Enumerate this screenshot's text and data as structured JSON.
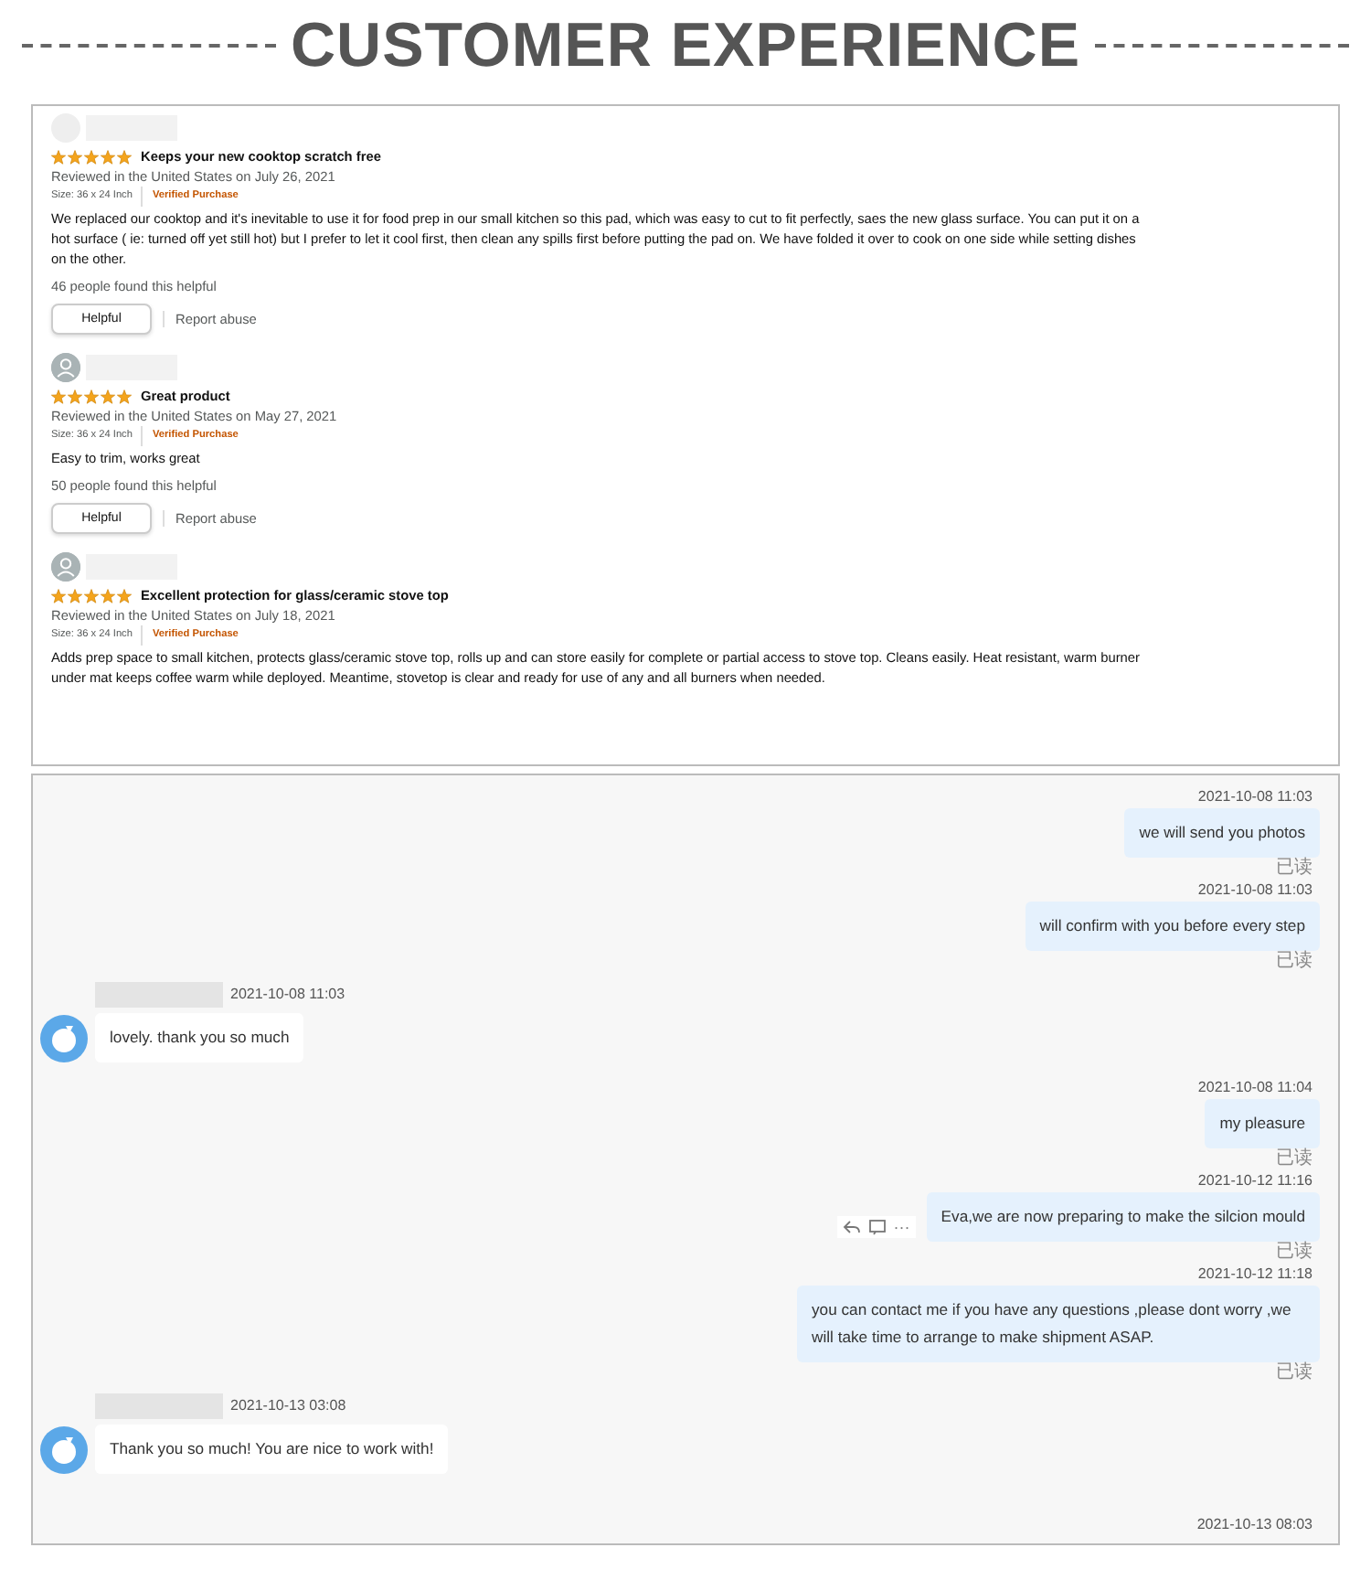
{
  "heading": "CUSTOMER EXPERIENCE",
  "reviews": [
    {
      "avatar": {
        "kind": "blank"
      },
      "stars": 5,
      "title": "Keeps your new cooktop scratch free",
      "reviewed": "Reviewed in the United States on July 26, 2021",
      "size": "Size: 36 x 24 Inch",
      "badge": "Verified Purchase",
      "body": "We replaced our cooktop and it's inevitable to use it for food prep in our small kitchen so this pad, which was easy to cut to fit perfectly, saes the new glass surface. You can put it on a hot surface ( ie: turned off yet still hot) but I prefer to let it cool first, then clean any spills first before putting the pad on. We have folded it over to cook on one side while setting dishes on the other.",
      "helpful_count": "46 people found this helpful",
      "helpful_button": "Helpful",
      "report": "Report abuse"
    },
    {
      "avatar": {
        "kind": "person"
      },
      "stars": 5,
      "title": "Great product",
      "reviewed": "Reviewed in the United States on May 27, 2021",
      "size": "Size: 36 x 24 Inch",
      "badge": "Verified Purchase",
      "body": "Easy to trim, works great",
      "helpful_count": "50 people found this helpful",
      "helpful_button": "Helpful",
      "report": "Report abuse"
    },
    {
      "avatar": {
        "kind": "person"
      },
      "stars": 5,
      "title": "Excellent protection for glass/ceramic stove top",
      "reviewed": "Reviewed in the United States on July 18, 2021",
      "size": "Size: 36 x 24 Inch",
      "badge": "Verified Purchase",
      "body": "Adds prep space to small kitchen, protects glass/ceramic stove top, rolls up and can store easily for complete or partial access to stove top. Cleans easily. Heat resistant, warm burner under mat keeps coffee warm while deployed. Meantime, stovetop is clear and ready for use of any and all burners when needed."
    }
  ],
  "chat": [
    {
      "kind": "outgoing",
      "time": "2021-10-08 11:03",
      "text": "we will send you photos",
      "status": "已读",
      "show_actions": false
    },
    {
      "kind": "outgoing",
      "time": "2021-10-08 11:03",
      "text": "will confirm with you before every step",
      "status": "已读",
      "show_actions": false
    },
    {
      "kind": "incoming",
      "time": "2021-10-08 11:03",
      "text": "lovely. thank you so much"
    },
    {
      "kind": "outgoing",
      "time": "2021-10-08 11:04",
      "text": "my pleasure",
      "status": "已读",
      "show_actions": false
    },
    {
      "kind": "outgoing",
      "time": "2021-10-12 11:16",
      "text": "Eva,we are now preparing to make the silcion mould",
      "status": "已读",
      "show_actions": true,
      "more": "···"
    },
    {
      "kind": "outgoing",
      "time": "2021-10-12 11:18",
      "text": "you can contact me if you have any questions ,please dont worry ,we will take time to arrange to make shipment ASAP.",
      "status": "已读",
      "show_actions": false
    },
    {
      "kind": "incoming",
      "time": "2021-10-13 03:08",
      "text": "Thank you so much! You are nice to work with!"
    },
    {
      "kind": "time",
      "time": "2021-10-13 08:03"
    }
  ]
}
